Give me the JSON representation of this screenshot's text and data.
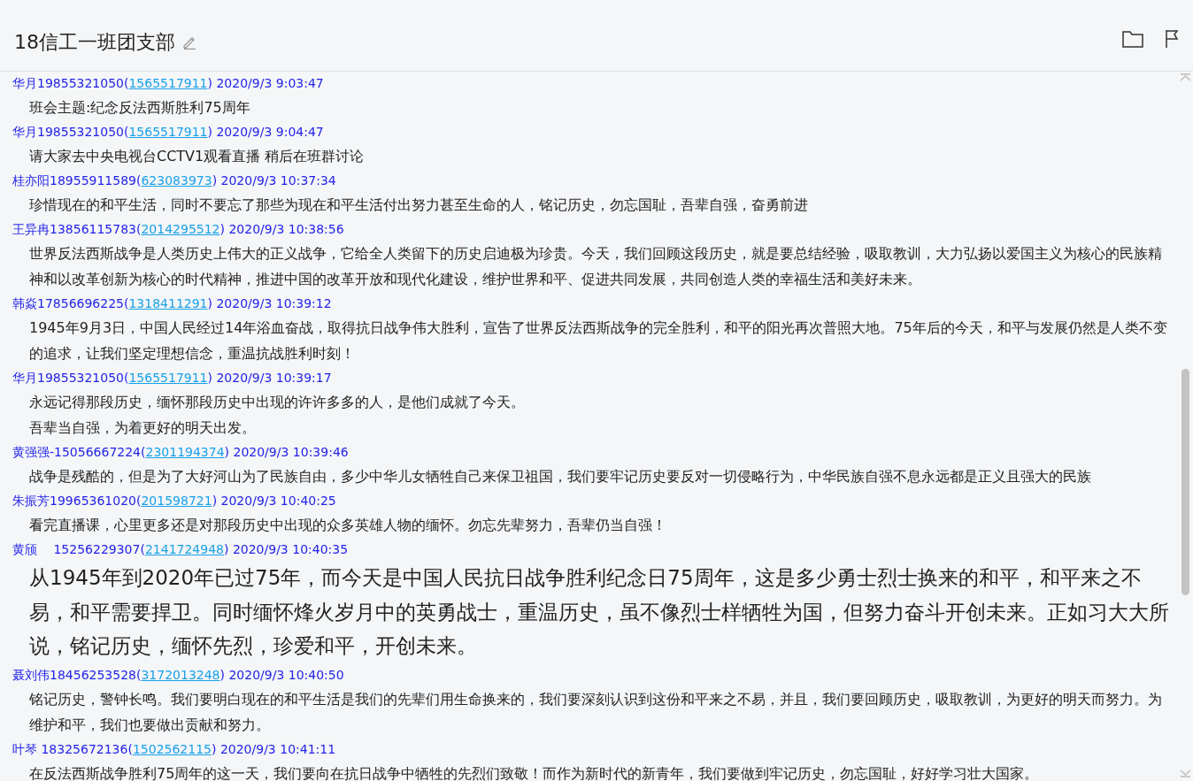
{
  "title": "18信工一班团支部",
  "messages": [
    {
      "prefix": "华月19855321050(",
      "qq": "1565517911",
      "suffix": ") 2020/9/3 9:03:47",
      "kind": "normal",
      "paragraphs": [
        "班会主题:纪念反法西斯胜利75周年"
      ]
    },
    {
      "prefix": "华月19855321050(",
      "qq": "1565517911",
      "suffix": ") 2020/9/3 9:04:47",
      "kind": "normal",
      "paragraphs": [
        "请大家去中央电视台CCTV1观看直播 稍后在班群讨论"
      ]
    },
    {
      "prefix": "桂亦阳18955911589(",
      "qq": "623083973",
      "suffix": ") 2020/9/3 10:37:34",
      "kind": "normal",
      "paragraphs": [
        "珍惜现在的和平生活，同时不要忘了那些为现在和平生活付出努力甚至生命的人，铭记历史，勿忘国耻，吾辈自强，奋勇前进"
      ]
    },
    {
      "prefix": "王异冉13856115783(",
      "qq": "2014295512",
      "suffix": ") 2020/9/3 10:38:56",
      "kind": "normal",
      "paragraphs": [
        "世界反法西斯战争是人类历史上伟大的正义战争，它给全人类留下的历史启迪极为珍贵。今天，我们回顾这段历史，就是要总结经验，吸取教训，大力弘扬以爱国主义为核心的民族精神和以改革创新为核心的时代精神，推进中国的改革开放和现代化建设，维护世界和平、促进共同发展，共同创造人类的幸福生活和美好未来。"
      ]
    },
    {
      "prefix": "韩焱17856696225(",
      "qq": "1318411291",
      "suffix": ") 2020/9/3 10:39:12",
      "kind": "normal",
      "paragraphs": [
        "1945年9月3日，中国人民经过14年浴血奋战，取得抗日战争伟大胜利，宣告了世界反法西斯战争的完全胜利，和平的阳光再次普照大地。75年后的今天，和平与发展仍然是人类不变的追求，让我们坚定理想信念，重温抗战胜利时刻！"
      ]
    },
    {
      "prefix": "华月19855321050(",
      "qq": "1565517911",
      "suffix": ") 2020/9/3 10:39:17",
      "kind": "normal",
      "paragraphs": [
        "永远记得那段历史，缅怀那段历史中出现的许许多多的人，是他们成就了今天。",
        "吾辈当自强，为着更好的明天出发。"
      ]
    },
    {
      "prefix": "黄强强-15056667224(",
      "qq": "2301194374",
      "suffix": ") 2020/9/3 10:39:46",
      "kind": "normal",
      "paragraphs": [
        "战争是残酷的，但是为了大好河山为了民族自由，多少中华儿女牺牲自己来保卫祖国，我们要牢记历史要反对一切侵略行为，中华民族自强不息永远都是正义且强大的民族"
      ]
    },
    {
      "prefix": "朱振芳19965361020(",
      "qq": "201598721",
      "suffix": ") 2020/9/3 10:40:25",
      "kind": "normal",
      "paragraphs": [
        "看完直播课，心里更多还是对那段历史中出现的众多英雄人物的缅怀。勿忘先辈努力，吾辈仍当自强！"
      ]
    },
    {
      "prefix": "黄颀　 15256229307(",
      "qq": "2141724948",
      "suffix": ") 2020/9/3 10:40:35",
      "kind": "large",
      "paragraphs": [
        "从1945年到2020年已过75年，而今天是中国人民抗日战争胜利纪念日75周年，这是多少勇士烈士换来的和平，和平来之不易，和平需要捍卫。同时缅怀烽火岁月中的英勇战士，重温历史，虽不像烈士样牺牲为国，但努力奋斗开创未来。正如习大大所说，铭记历史，缅怀先烈，珍爱和平，开创未来。"
      ]
    },
    {
      "prefix": "聂刘伟18456253528(",
      "qq": "3172013248",
      "suffix": ") 2020/9/3 10:40:50",
      "kind": "normal",
      "paragraphs": [
        "铭记历史，警钟长鸣。我们要明白现在的和平生活是我们的先辈们用生命换来的，我们要深刻认识到这份和平来之不易，并且，我们要回顾历史，吸取教训，为更好的明天而努力。为维护和平，我们也要做出贡献和努力。"
      ]
    },
    {
      "prefix": "叶琴 18325672136(",
      "qq": "1502562115",
      "suffix": ") 2020/9/3 10:41:11",
      "kind": "normal",
      "paragraphs": [
        "在反法西斯战争胜利75周年的这一天，我们要向在抗日战争中牺牲的先烈们致敬！而作为新时代的新青年，我们要做到牢记历史，勿忘国耻，好好学习壮大国家。"
      ]
    }
  ]
}
